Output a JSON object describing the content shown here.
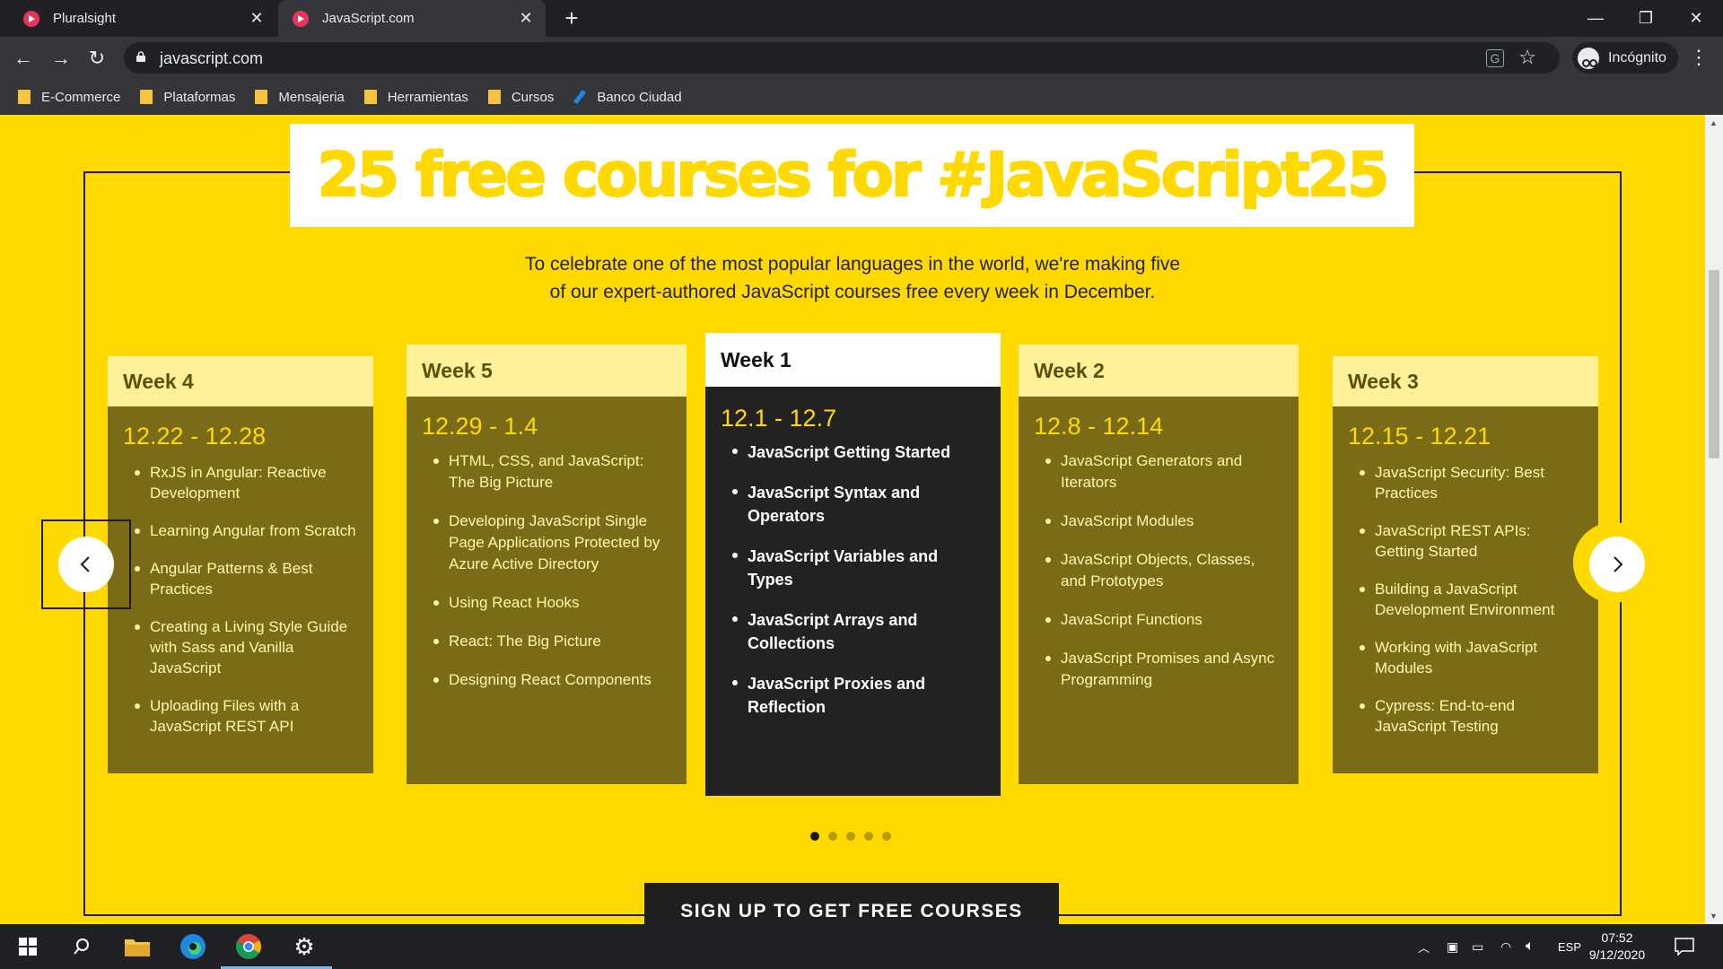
{
  "browser": {
    "tabs": [
      {
        "title": "Pluralsight",
        "active": false
      },
      {
        "title": "JavaScript.com",
        "active": true
      }
    ],
    "url": "javascript.com",
    "profile_label": "Incógnito",
    "bookmarks": [
      "E-Commerce",
      "Plataformas",
      "Mensajeria",
      "Herramientas",
      "Cursos",
      "Banco Ciudad"
    ]
  },
  "page": {
    "title": "25 free courses for #JavaScript25",
    "intro_line1": "To celebrate one of the most popular languages in the world, we're making five",
    "intro_line2": "of our expert-authored JavaScript courses free every week in December.",
    "cards": [
      {
        "week": "Week 4",
        "dates": "12.22 - 12.28",
        "courses": [
          "RxJS in Angular: Reactive Development",
          "Learning Angular from Scratch",
          "Angular Patterns & Best Practices",
          "Creating a Living Style Guide with Sass and Vanilla JavaScript",
          "Uploading Files with a JavaScript REST API"
        ]
      },
      {
        "week": "Week 5",
        "dates": "12.29 - 1.4",
        "courses": [
          "HTML, CSS, and JavaScript: The Big Picture",
          "Developing JavaScript Single Page Applications Protected by Azure Active Directory",
          "Using React Hooks",
          "React: The Big Picture",
          "Designing React Components"
        ]
      },
      {
        "week": "Week 1",
        "dates": "12.1 - 12.7",
        "courses": [
          "JavaScript Getting Started",
          "JavaScript Syntax and Operators",
          "JavaScript Variables and Types",
          "JavaScript Arrays and Collections",
          "JavaScript Proxies and Reflection"
        ]
      },
      {
        "week": "Week 2",
        "dates": "12.8 - 12.14",
        "courses": [
          "JavaScript Generators and Iterators",
          "JavaScript Modules",
          "JavaScript Objects, Classes, and Prototypes",
          "JavaScript Functions",
          "JavaScript Promises and Async Programming"
        ]
      },
      {
        "week": "Week 3",
        "dates": "12.15 - 12.21",
        "courses": [
          "JavaScript Security: Best Practices",
          "JavaScript REST APIs: Getting Started",
          "Building a JavaScript Development Environment",
          "Working with JavaScript Modules",
          "Cypress: End-to-end JavaScript Testing"
        ]
      }
    ],
    "carousel_pages": 5,
    "carousel_active_page": 1,
    "cta_label": "SIGN UP TO GET FREE COURSES"
  },
  "taskbar": {
    "language": "ESP",
    "time": "07:52",
    "date": "9/12/2020"
  },
  "colors": {
    "page_bg": "#ffd900",
    "card_bg": "#7a6c16",
    "card_head": "#fff19a",
    "active_card_bg": "#222222"
  }
}
